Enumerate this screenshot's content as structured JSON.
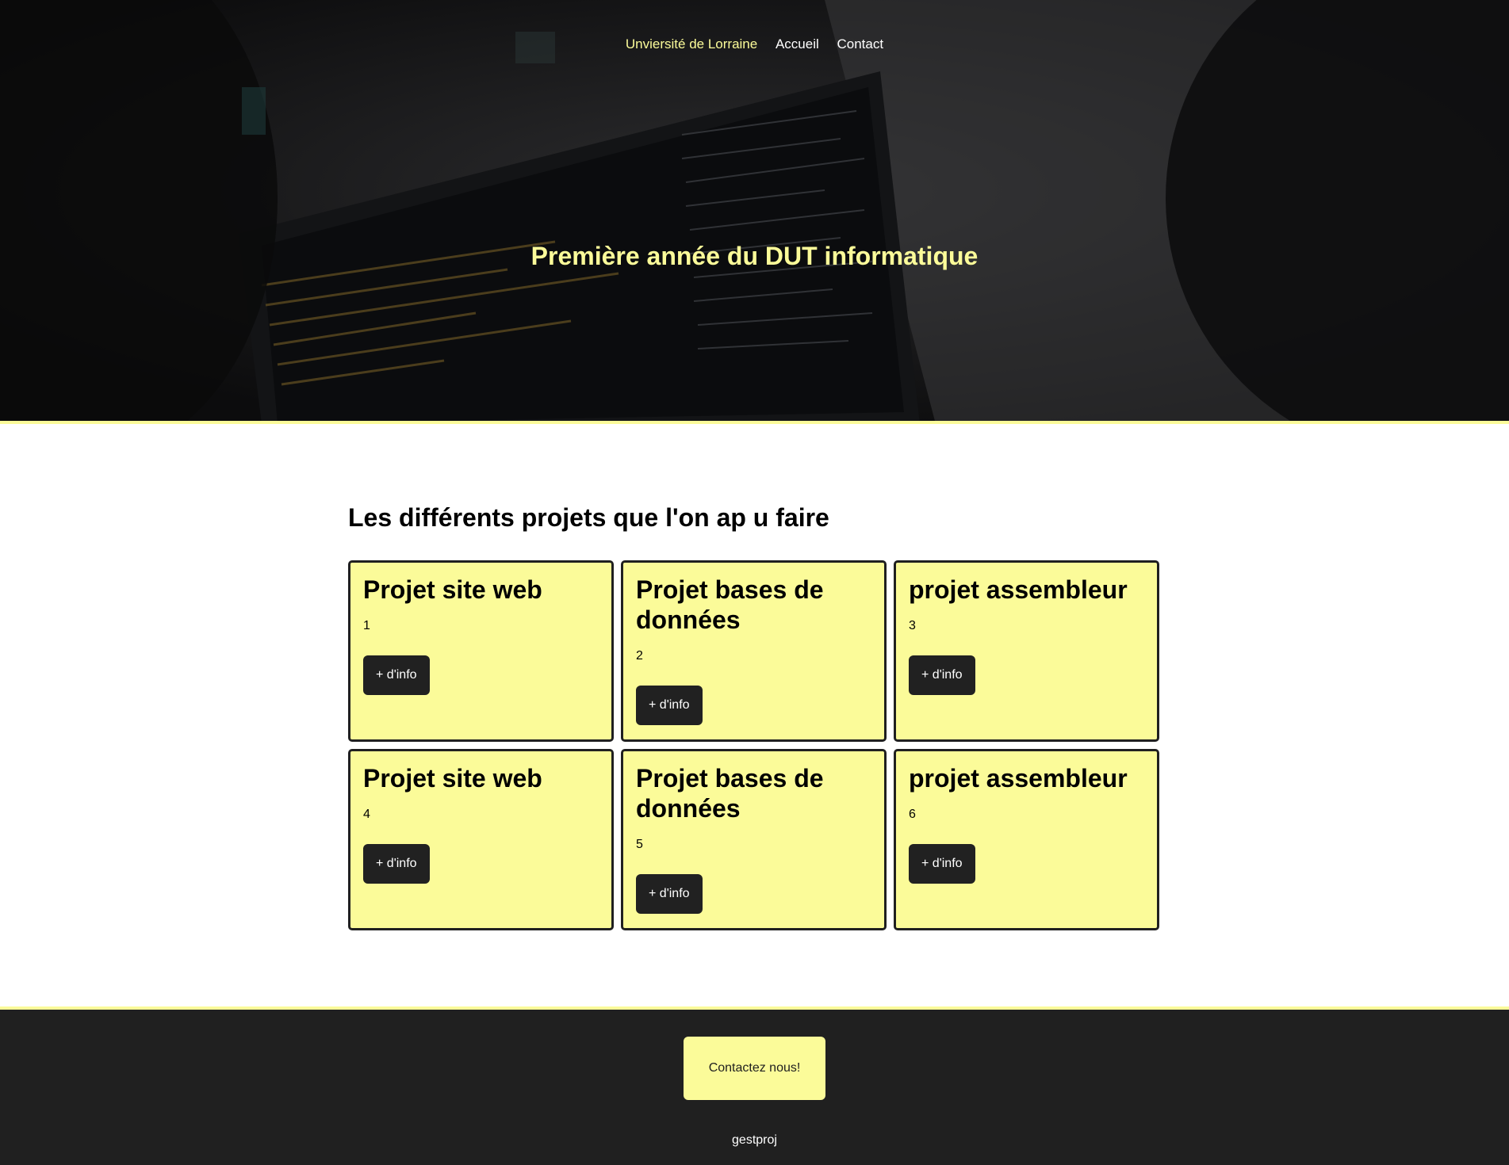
{
  "nav": {
    "brand": "Unviersité de Lorraine",
    "items": [
      "Accueil",
      "Contact"
    ]
  },
  "hero": {
    "title": "Première année du DUT informatique"
  },
  "projects": {
    "heading": "Les différents projets que l'on ap u faire",
    "cards": [
      {
        "title": "Projet site web",
        "number": "1",
        "button": "+ d'info"
      },
      {
        "title": "Projet bases de données",
        "number": "2",
        "button": "+ d'info"
      },
      {
        "title": "projet assembleur",
        "number": "3",
        "button": "+ d'info"
      },
      {
        "title": "Projet site web",
        "number": "4",
        "button": "+ d'info"
      },
      {
        "title": "Projet bases de données",
        "number": "5",
        "button": "+ d'info"
      },
      {
        "title": "projet assembleur",
        "number": "6",
        "button": "+ d'info"
      }
    ]
  },
  "footer": {
    "contact_button": "Contactez nous!",
    "text": "gestproj"
  },
  "colors": {
    "accent": "#fbfb99",
    "dark": "#202020",
    "hero_text": "#fbfb99"
  }
}
